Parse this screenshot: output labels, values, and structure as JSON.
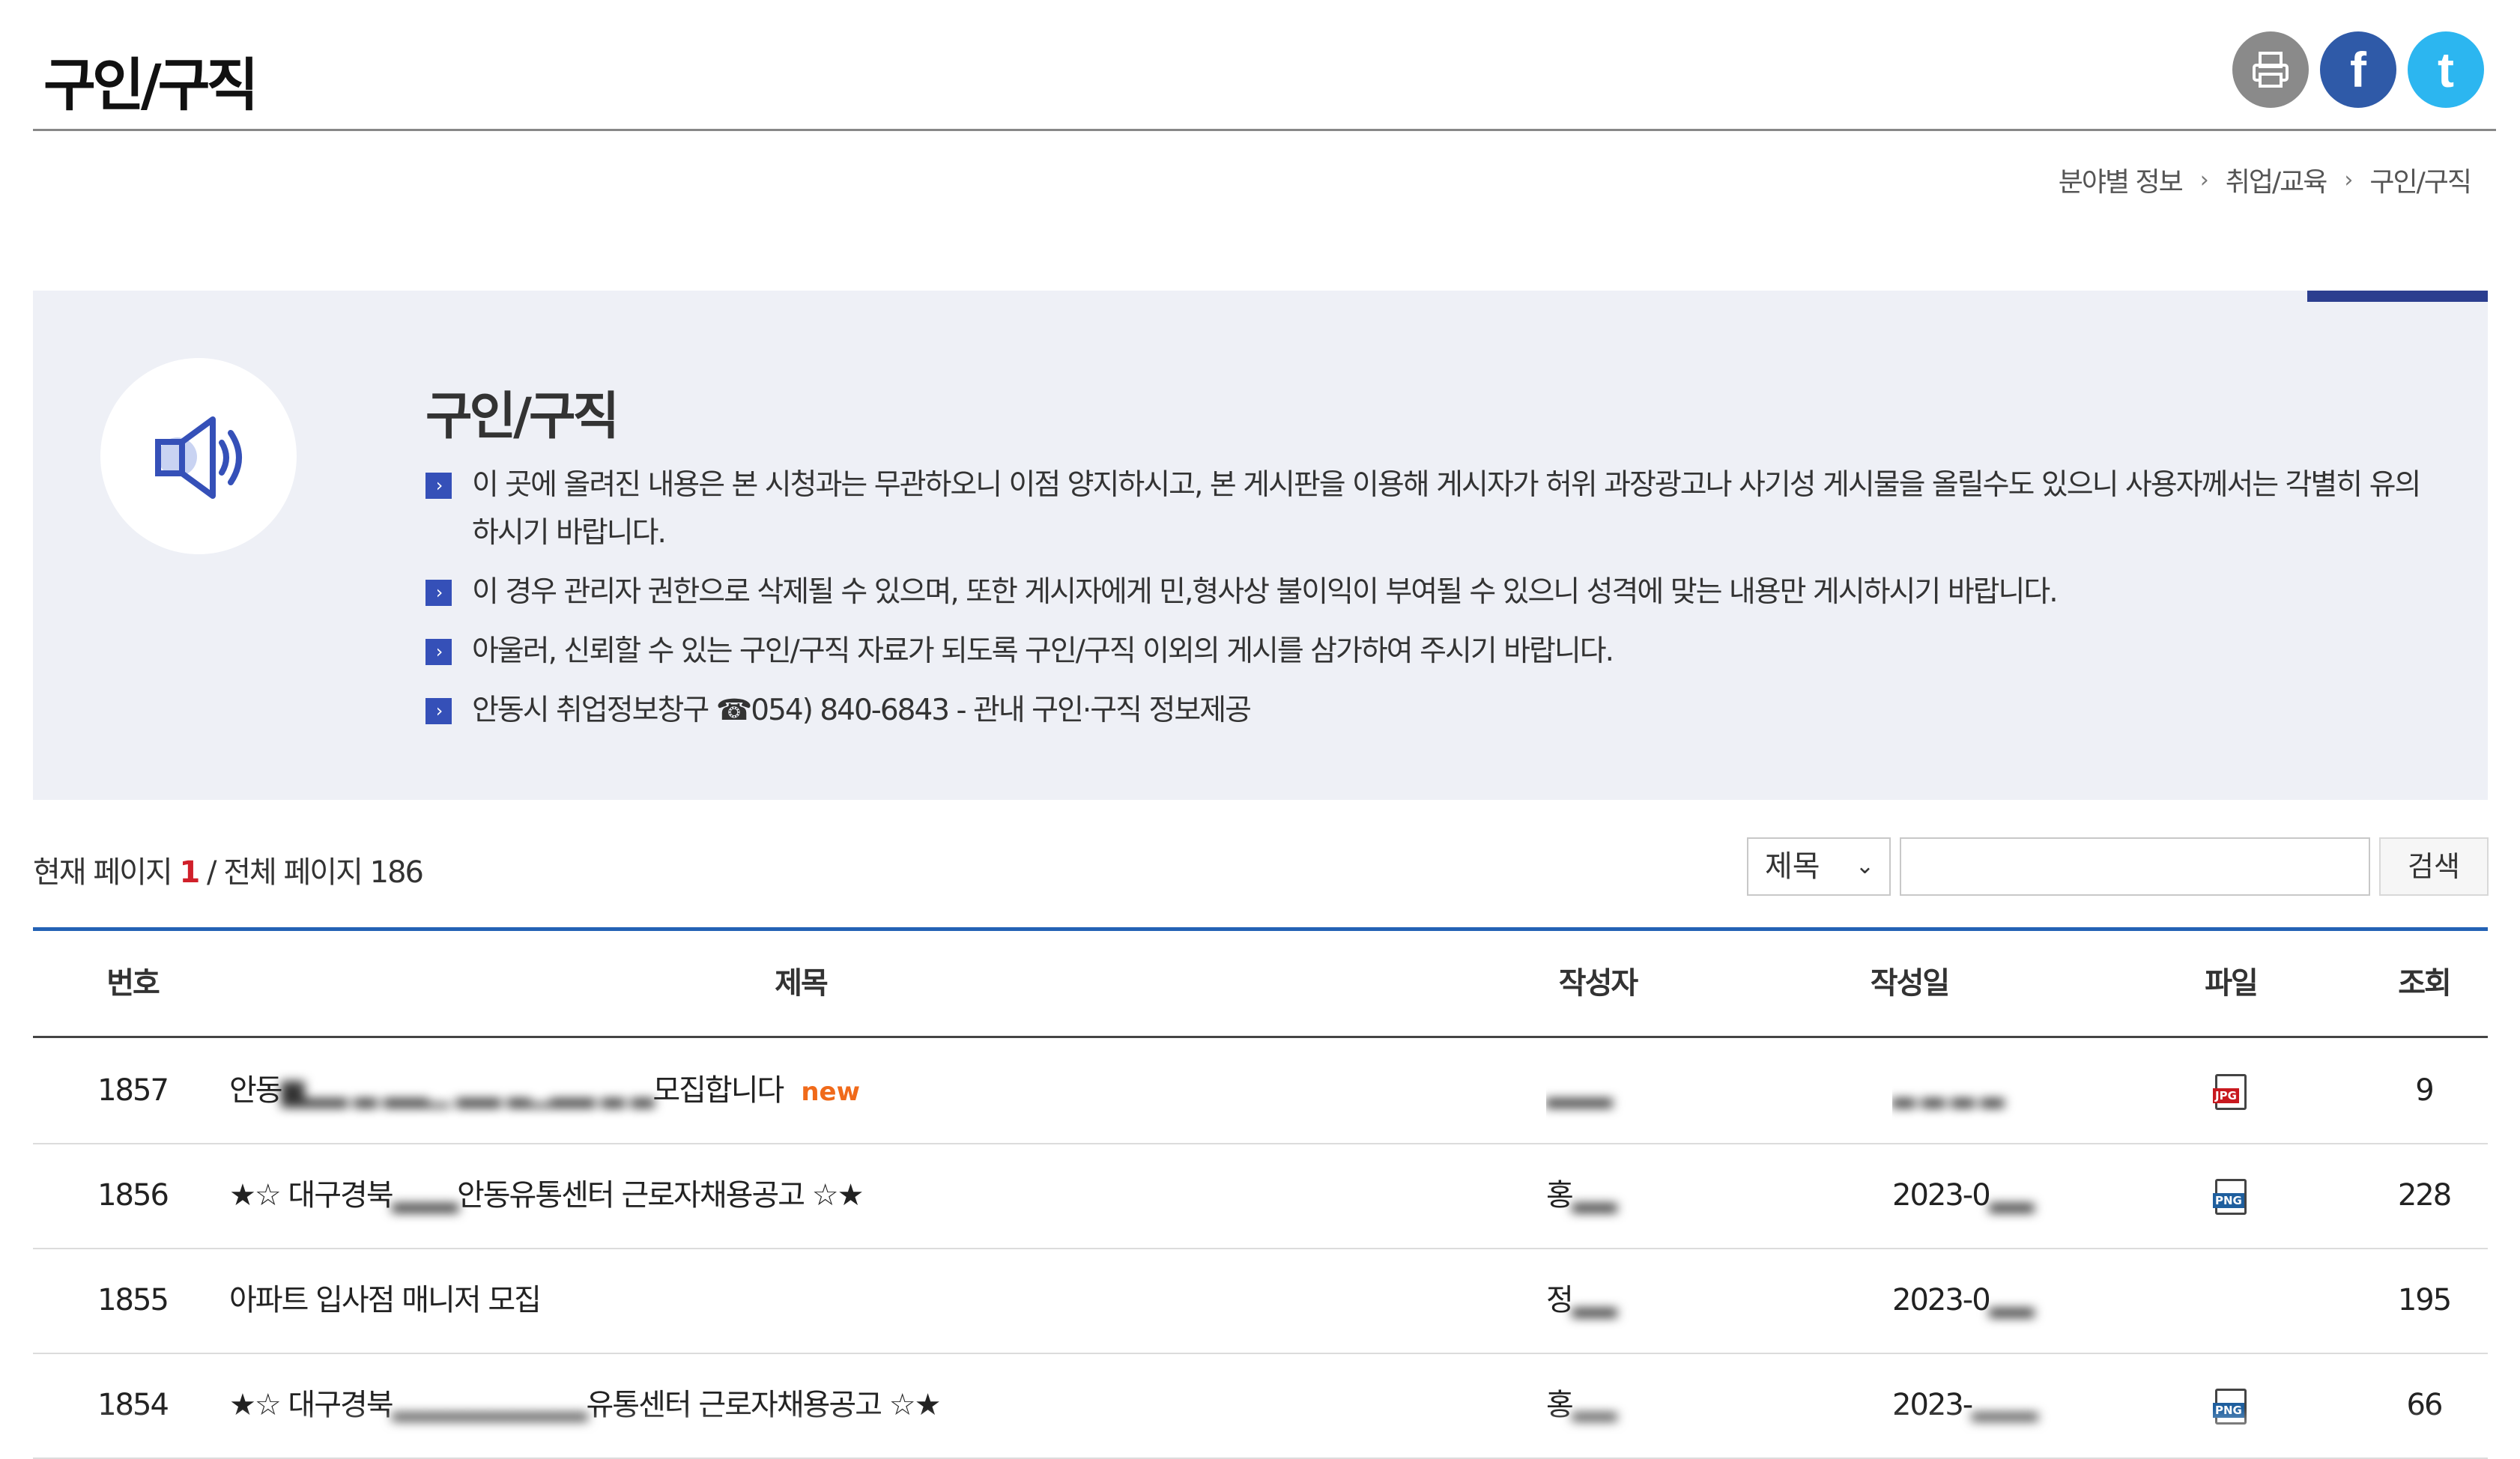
{
  "page": {
    "title": "구인/구직",
    "social": [
      "printer-icon",
      "facebook-icon",
      "twitter-icon"
    ]
  },
  "breadcrumb": [
    "분야별 정보",
    "취업/교육",
    "구인/구직"
  ],
  "notice": {
    "icon": "speaker-icon",
    "title": "구인/구직",
    "bullets": [
      "이 곳에 올려진 내용은 본 시청과는 무관하오니 이점 양지하시고, 본 게시판을 이용해 게시자가 허위 과장광고나 사기성 게시물을 올릴수도 있으니 사용자께서는 각별히 유의하시기 바랍니다.",
      "이 경우 관리자 권한으로 삭제될 수 있으며, 또한 게시자에게 민,형사상 불이익이 부여될 수 있으니 성격에 맞는 내용만 게시하시기 바랍니다.",
      "아울러, 신뢰할 수 있는 구인/구직 자료가 되도록 구인/구직 이외의 게시를 삼가하여 주시기 바랍니다.",
      "안동시 취업정보창구 ☎054) 840-6843 - 관내 구인·구직 정보제공"
    ],
    "bullet_mark": "›"
  },
  "paging": {
    "current_label": "현재 페이지",
    "current": "1",
    "total_label": "/ 전체 페이지",
    "total": "186"
  },
  "search": {
    "field_selected": "제목",
    "input_value": "",
    "button_label": "검색"
  },
  "table": {
    "columns": [
      "번호",
      "제목",
      "작성자",
      "작성일",
      "파일",
      "조회"
    ],
    "rows": [
      {
        "num": "1857",
        "subject_start": "안동",
        "subject_end": "모집합니다",
        "new": "new",
        "writer": "",
        "date": "",
        "file": "JPG",
        "views": "9"
      },
      {
        "num": "1856",
        "subject_start": "★☆ 대구경북",
        "subject_end": "안동유통센터 근로자채용공고 ☆★",
        "new": "",
        "writer": "홍",
        "date": "2023-0",
        "file": "PNG",
        "views": "228"
      },
      {
        "num": "1855",
        "subject_start": "아파트 입사점 매니저 모집",
        "subject_end": "",
        "new": "",
        "writer": "정",
        "date": "2023-0",
        "file": "",
        "views": "195"
      },
      {
        "num": "1854",
        "subject_start": "★☆ 대구경북",
        "subject_end": "유통센터 근로자채용공고 ☆★",
        "new": "",
        "writer": "홍",
        "date": "2023-",
        "file": "PNG",
        "views": "66"
      }
    ]
  },
  "colors": {
    "accent_blue": "#2462b5",
    "notice_bg": "#eef0f6",
    "new_badge": "#f06a1a",
    "current_page": "#d0202a"
  }
}
